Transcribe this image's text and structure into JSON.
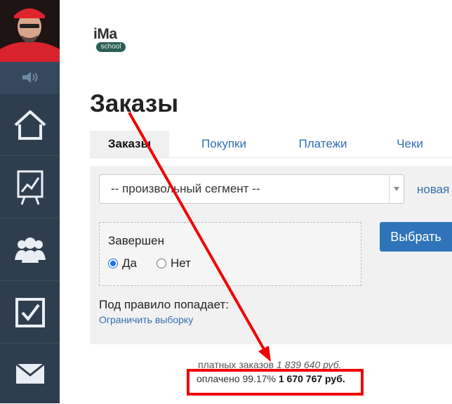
{
  "sidebar": {
    "items": [
      {
        "icon": "speaker-icon"
      },
      {
        "icon": "home-icon"
      },
      {
        "icon": "chart-board-icon"
      },
      {
        "icon": "users-icon"
      },
      {
        "icon": "checkbox-icon"
      },
      {
        "icon": "mail-icon"
      }
    ]
  },
  "logo": {
    "main": "iMa",
    "sub": "school"
  },
  "page": {
    "title": "Заказы"
  },
  "tabs": [
    {
      "label": "Заказы",
      "active": true
    },
    {
      "label": "Покупки",
      "active": false
    },
    {
      "label": "Платежи",
      "active": false
    },
    {
      "label": "Чеки",
      "active": false
    }
  ],
  "filter": {
    "segment_value": "-- произвольный сегмент --",
    "new_link": "новая",
    "condition_title": "Завершен",
    "options": [
      {
        "label": "Да",
        "checked": true
      },
      {
        "label": "Нет",
        "checked": false
      }
    ],
    "select_button": "Выбрать",
    "rule_label": "Под правило попадает:",
    "limit_link": "Ограничить выборку"
  },
  "summary": {
    "paid_orders_label": "платных заказов",
    "paid_orders_amount": "1 839 640 руб.",
    "paid_label": "оплачено 99.17%",
    "paid_amount": "1 670 767 руб."
  },
  "colors": {
    "sidebar": "#2f3e4f",
    "accent": "#2f74b8",
    "link": "#2f6fb3",
    "annotation": "#f00000"
  }
}
